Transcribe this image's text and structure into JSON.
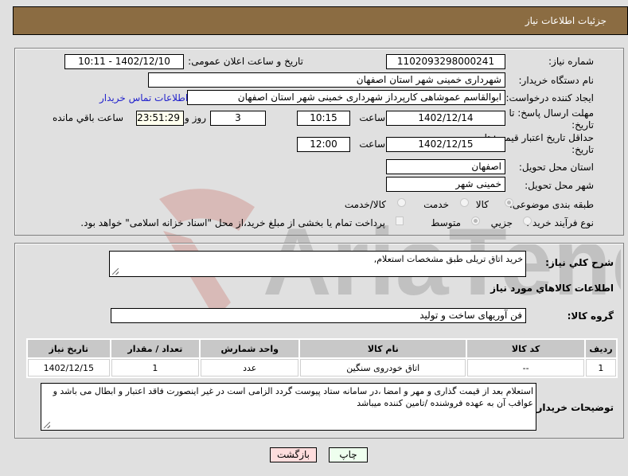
{
  "header": {
    "title": "جزئیات اطلاعات نیاز"
  },
  "fields": {
    "need_number_label": "شماره نیاز:",
    "need_number": "1102093298000241",
    "announce_label": "تاریخ و ساعت اعلان عمومی:",
    "announce_value": "1402/12/10 - 10:11",
    "buyer_org_label": "نام دستگاه خریدار:",
    "buyer_org": "شهرداری خمینی شهر استان اصفهان",
    "creator_label": "ایجاد کننده درخواست:",
    "creator": "ابوالقاسم عموشاهی کارپرداز شهرداری خمینی شهر استان اصفهان",
    "contact_link": "اطلاعات تماس خریدار",
    "deadline_label_line1": "مهلت ارسال پاسخ: تا",
    "deadline_label_line2": "تاریخ:",
    "deadline_date": "1402/12/14",
    "time_label": "ساعت",
    "deadline_time": "10:15",
    "days_value": "3",
    "days_label": "روز و",
    "remaining_time": "23:51:29",
    "remaining_label": "ساعت باقي مانده",
    "validity_label_line1": "حداقل تاریخ اعتبار قیمت: تا",
    "validity_label_line2": "تاریخ:",
    "validity_date": "1402/12/15",
    "validity_time": "12:00",
    "province_label": "استان محل تحویل:",
    "province": "اصفهان",
    "city_label": "شهر محل تحویل:",
    "city": "خمینی شهر",
    "category_label": "طبقه بندی موضوعی:",
    "category_options": [
      "کالا",
      "خدمت",
      "کالا/خدمت"
    ],
    "category_selected": "کالا",
    "process_label": "نوع فرآیند خرید :",
    "process_options": [
      "جزیي",
      "متوسط"
    ],
    "treasury_note": "پرداخت تمام یا بخشی از مبلغ خرید،از محل \"اسناد خزانه اسلامی\" خواهد بود."
  },
  "description": {
    "label": "شرح کلي نیاز:",
    "value": "خرید اتاق تریلی طبق مشخصات استعلام,"
  },
  "goods_section": {
    "title": "اطلاعات کالاهاي مورد نیاز",
    "group_label": "گروه کالا:",
    "group_value": "فن آوریهای ساخت و تولید",
    "columns": [
      "ردیف",
      "کد کالا",
      "نام کالا",
      "واحد شمارش",
      "تعداد / مقدار",
      "تاریخ نیاز"
    ],
    "rows": [
      [
        "1",
        "--",
        "اتاق خودروی سنگین",
        "عدد",
        "1",
        "1402/12/15"
      ]
    ]
  },
  "buyer_notes": {
    "label": "توضیحات خریدار:",
    "value": "استعلام بعد از قیمت گذاری و مهر و امضا ،در سامانه ستاد پیوست گردد الزامی است در غیر اینصورت فاقد اعتبار و ابطال می باشد و عواقب آن به عهده فروشنده /تامین کننده میباشد"
  },
  "buttons": {
    "print": "چاپ",
    "back": "بازگشت"
  },
  "colors": {
    "header_bg": "#8b6c42",
    "print_bg": "#eeffee",
    "back_bg": "#ffdddd",
    "link": "#2222cc"
  },
  "watermark": "AriaTender.neT"
}
